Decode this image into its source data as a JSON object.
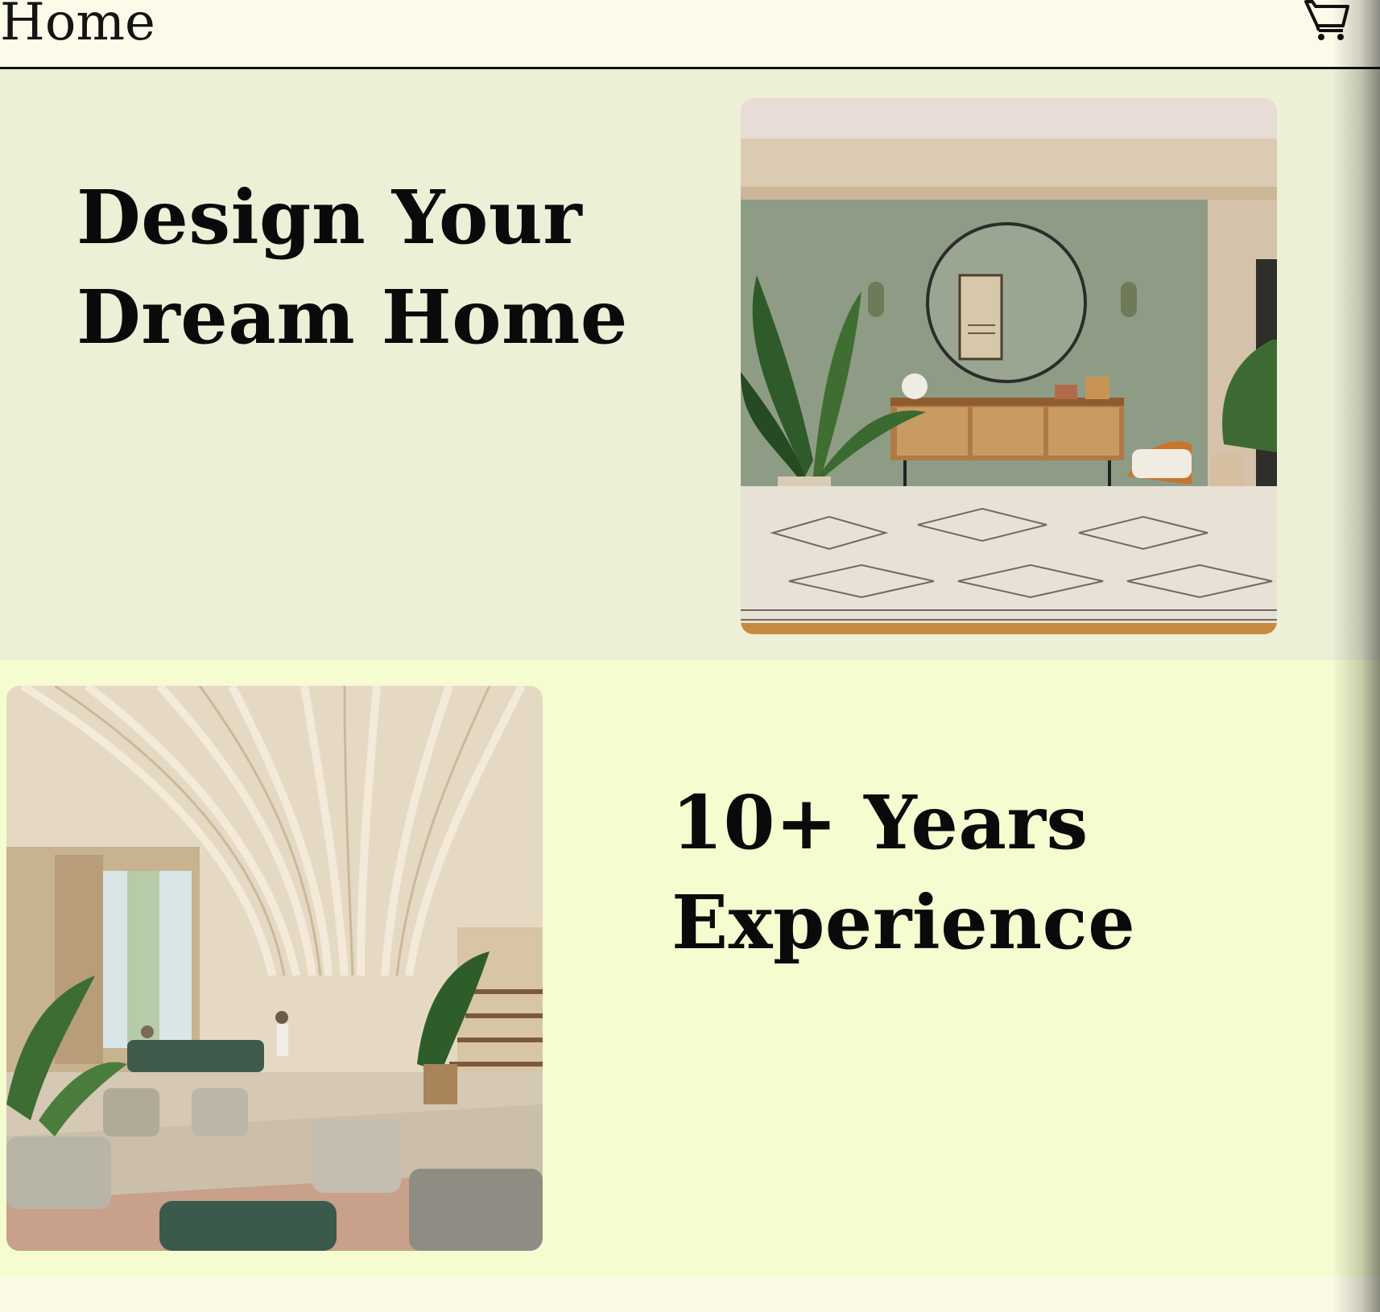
{
  "header": {
    "title": "Home",
    "cart_icon": "shopping-cart-icon"
  },
  "hero": {
    "headline_line1": "Design Your",
    "headline_line2": "Dream Home",
    "image_subject": "living room with green wall, round mirror, rattan sideboard, plants and patterned rug"
  },
  "experience": {
    "headline_line1": "10+ Years",
    "headline_line2": "Experience",
    "image_subject": "bright lounge hall with curved wooden ceiling ribs, armchairs, sofa and plants"
  },
  "colors": {
    "header_bg": "#fcfbe9",
    "hero_bg": "#edefd7",
    "experience_bg": "#f5fcd0",
    "text": "#0a0a0a"
  }
}
